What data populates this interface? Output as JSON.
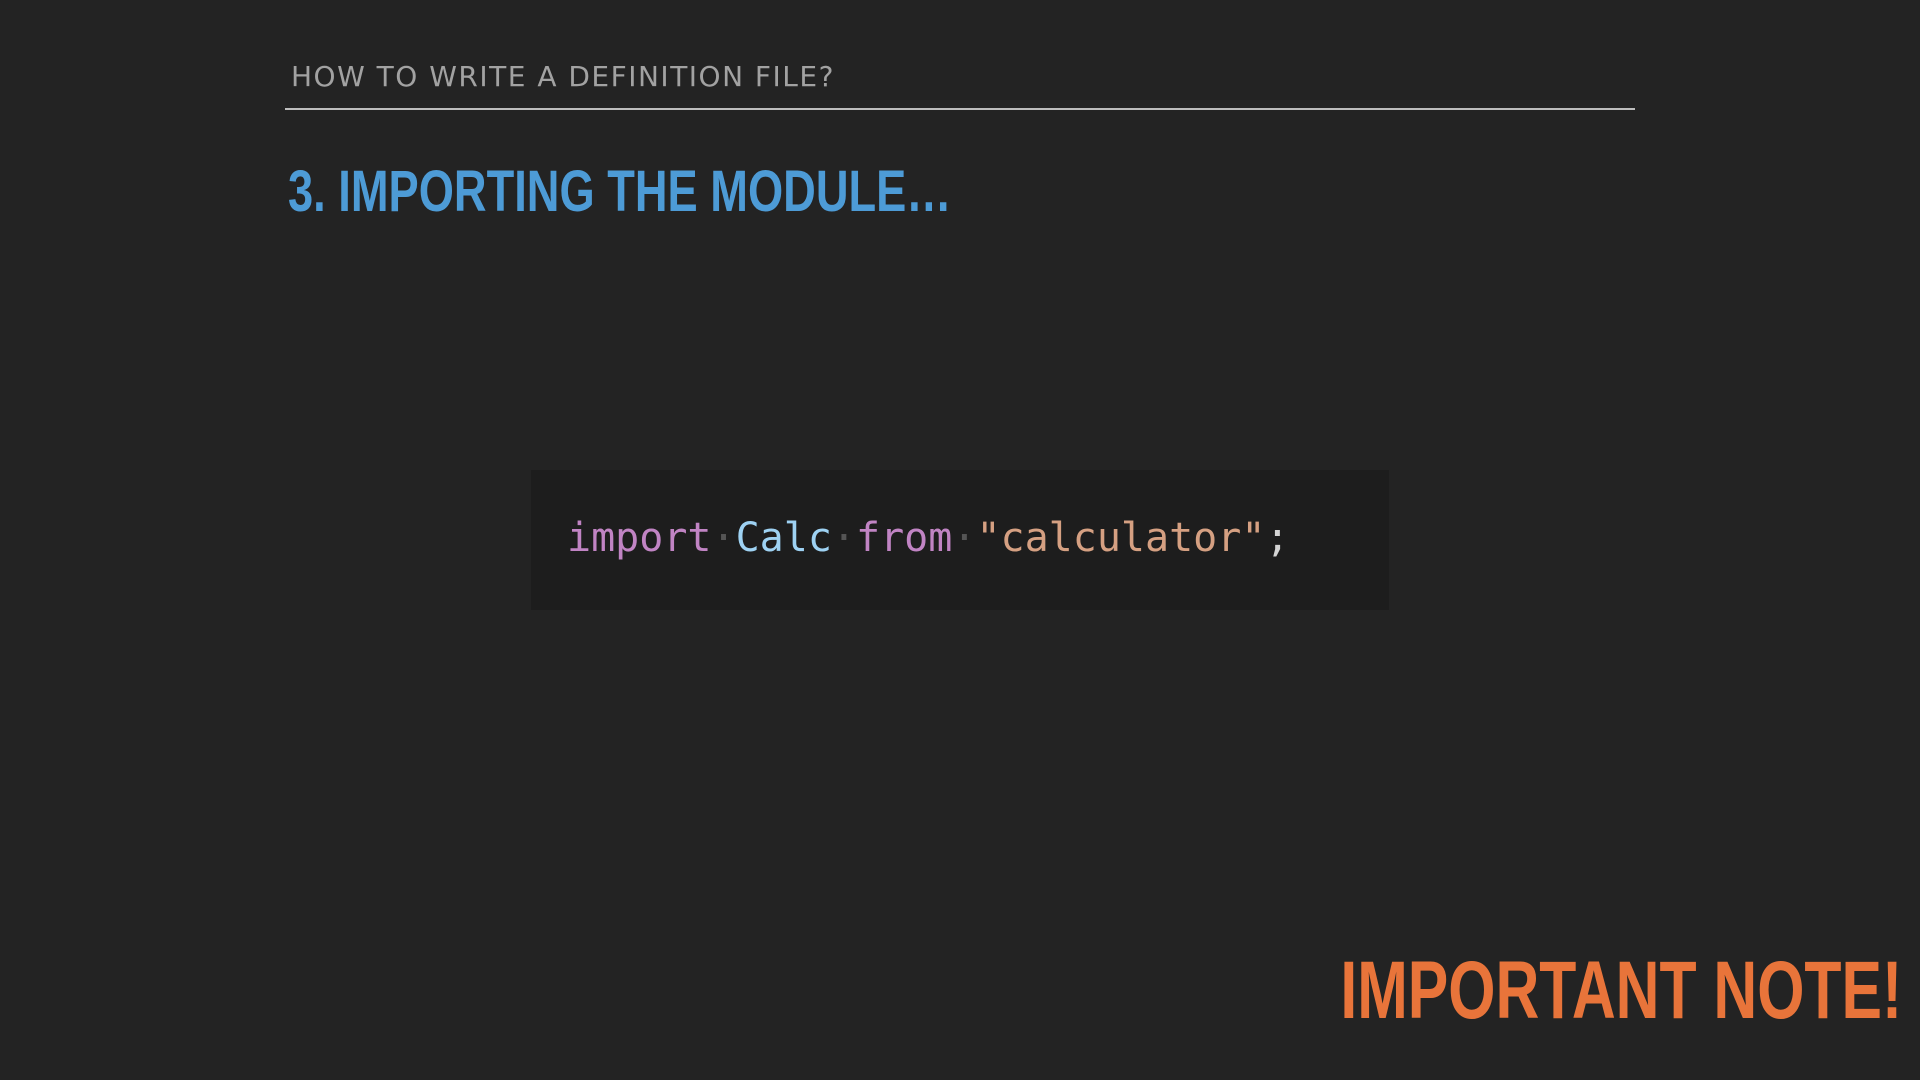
{
  "slide": {
    "header": "HOW TO WRITE A DEFINITION FILE?",
    "title": "3. IMPORTING THE MODULE…",
    "note": "IMPORTANT NOTE!"
  },
  "code": {
    "keyword_import": "import",
    "identifier": "Calc",
    "keyword_from": "from",
    "string": "\"calculator\"",
    "terminator": ";",
    "whitespace_marker": "·"
  },
  "colors": {
    "background": "#232323",
    "code_background": "#1d1d1d",
    "header_text": "#a2a2a2",
    "title_text": "#4d9bd6",
    "note_text": "#e8743a",
    "keyword": "#c184c4",
    "identifier": "#9ed2f3",
    "string": "#d5a082"
  }
}
